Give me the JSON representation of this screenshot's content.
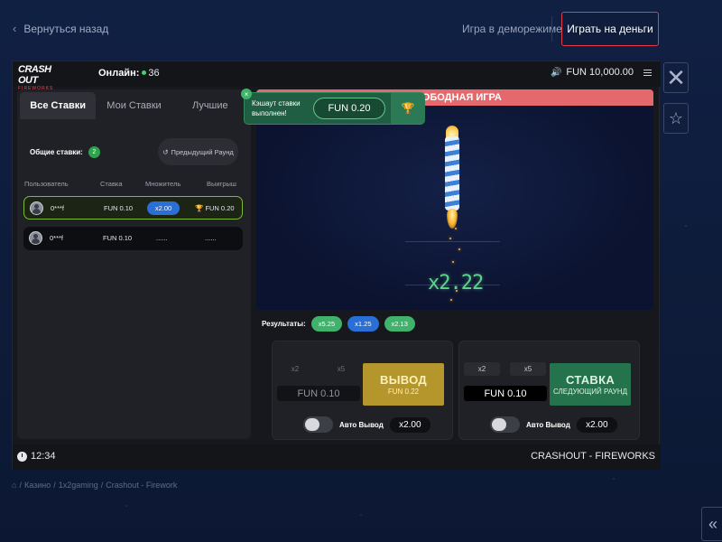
{
  "topbar": {
    "back_label": "Вернуться назад",
    "demo_label": "Игра в деморежиме",
    "real_label": "Играть на деньги"
  },
  "game": {
    "logo_main": "CRASH OUT",
    "logo_sub": "FIREWORKS",
    "online_label": "Онлайн:",
    "online_count": "36",
    "balance": "FUN 10,000.00",
    "tabs": [
      "Все Ставки",
      "Мои Ставки",
      "Лучшие"
    ],
    "totals_label": "Общие ставки:",
    "totals_count": "2",
    "prev_round_label": "Предыдущий Раунд",
    "columns": [
      "Пользователь",
      "Ставка",
      "Множитель",
      "Выигрыш"
    ],
    "rows": [
      {
        "user": "0***f",
        "bet": "FUN 0.10",
        "mult": "x2.00",
        "win": "FUN 0.20"
      },
      {
        "user": "0***f",
        "bet": "FUN 0.10",
        "mult": "......",
        "win": "......"
      }
    ],
    "banner": "СВОБОДНАЯ ИГРА",
    "current_multiplier": "x2.22",
    "toast": {
      "text": "Кэшаут ставки выполнен!",
      "amount": "FUN 0.20",
      "close": "×"
    },
    "results_label": "Результаты:",
    "results": [
      {
        "value": "x5.25",
        "color": "#3fb36b"
      },
      {
        "value": "x1.25",
        "color": "#2a6fd6"
      },
      {
        "value": "x2.13",
        "color": "#3fb36b"
      }
    ],
    "panel1": {
      "q1": "x2",
      "q2": "x5",
      "amount": "FUN 0.10",
      "action_big": "ВЫВОД",
      "action_small": "FUN 0.22",
      "auto_label": "Авто Вывод",
      "auto_value": "x2.00"
    },
    "panel2": {
      "q1": "x2",
      "q2": "x5",
      "amount": "FUN 0.10",
      "action_big": "СТАВКА",
      "action_small": "СЛЕДУЮЩИЙ РАУНД",
      "auto_label": "Авто Вывод",
      "auto_value": "x2.00"
    },
    "time": "12:34",
    "game_name": "CRASHOUT - FIREWORKS"
  },
  "breadcrumbs": [
    "Казино",
    "1x2gaming",
    "Crashout - Firework"
  ],
  "icons": {
    "back": "chevron-left-icon",
    "close": "close-icon",
    "star": "star-icon",
    "speaker": "speaker-icon",
    "menu": "menu-icon",
    "history": "history-icon",
    "trophy": "trophy-icon",
    "clock": "clock-icon",
    "home": "home-icon",
    "expand": "double-chevron-left-icon"
  }
}
